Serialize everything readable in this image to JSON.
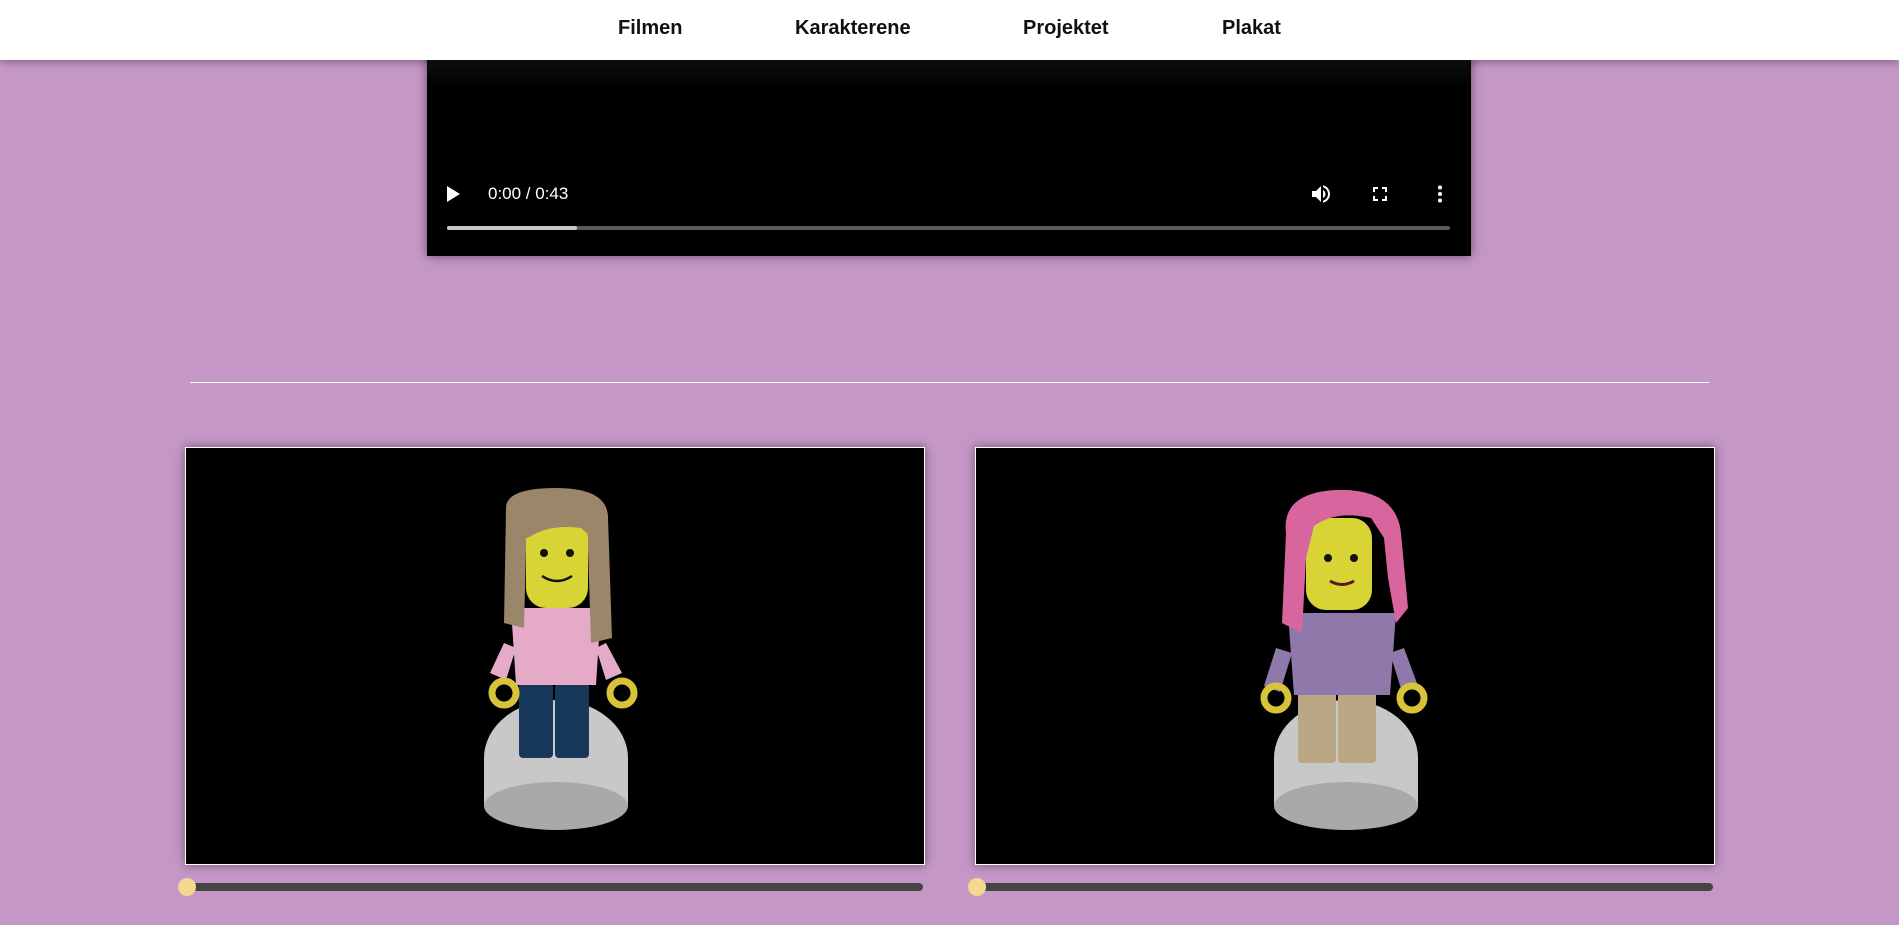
{
  "page": {
    "background": "#c597c7"
  },
  "nav": {
    "items": [
      {
        "label": "Filmen"
      },
      {
        "label": "Karakterene"
      },
      {
        "label": "Projektet"
      },
      {
        "label": "Plakat"
      }
    ]
  },
  "video": {
    "time_display": "0:00 / 0:43",
    "buffered_fraction": 0.13,
    "controls": [
      "play-icon",
      "volume-icon",
      "fullscreen-icon",
      "more-options-icon"
    ]
  },
  "characters": [
    {
      "hair_color": "#9c8669",
      "torso_color": "#e4aac8",
      "legs_color": "#173858",
      "rotation_slider_fraction": 0.0
    },
    {
      "hair_color": "#d9659f",
      "torso_color": "#8f78aa",
      "legs_color": "#b9a883",
      "rotation_slider_fraction": 0.0
    }
  ],
  "colors": {
    "skin": "#d8d436",
    "hands": "#d8c23a",
    "stand": "#c8c8c8",
    "slider_thumb": "#f2d98f",
    "slider_track": "#444444"
  }
}
